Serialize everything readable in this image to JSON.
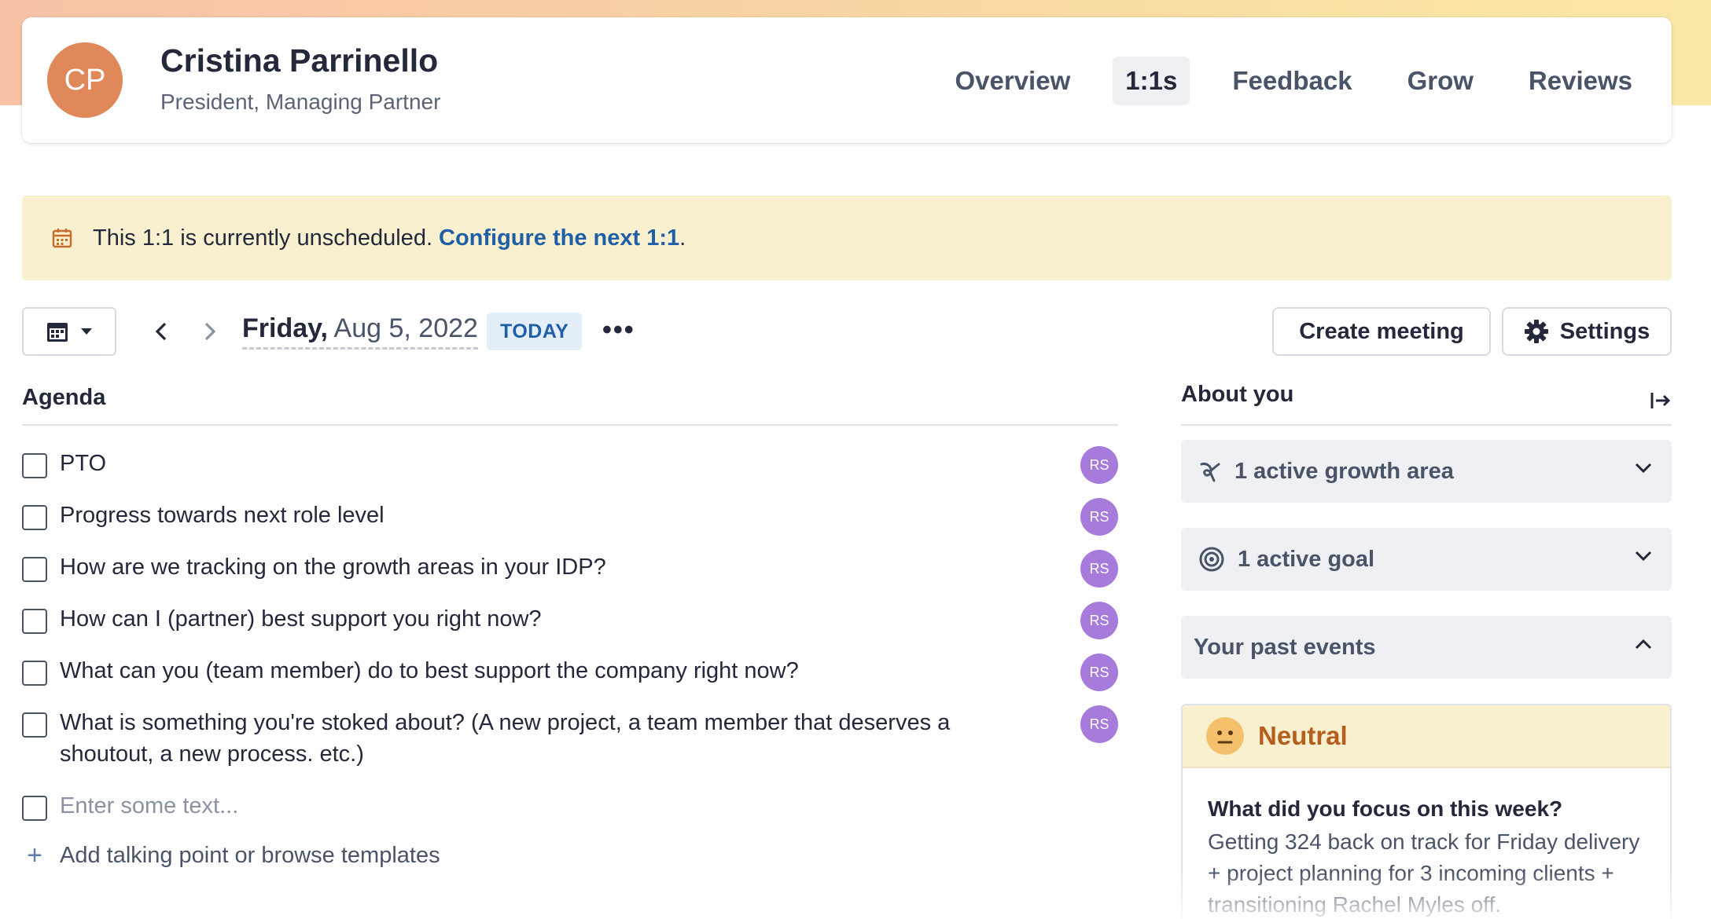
{
  "header": {
    "avatar_initials": "CP",
    "name": "Cristina Parrinello",
    "title": "President, Managing Partner",
    "tabs": [
      {
        "label": "Overview",
        "active": false
      },
      {
        "label": "1:1s",
        "active": true
      },
      {
        "label": "Feedback",
        "active": false
      },
      {
        "label": "Grow",
        "active": false
      },
      {
        "label": "Reviews",
        "active": false
      }
    ]
  },
  "banner": {
    "text": "This 1:1 is currently unscheduled.",
    "link": "Configure the next 1:1",
    "suffix": "."
  },
  "toolbar": {
    "weekday": "Friday,",
    "date": " Aug 5, 2022",
    "today_label": "TODAY",
    "more_label": "•••",
    "create_label": "Create meeting",
    "settings_label": "Settings"
  },
  "agenda": {
    "title": "Agenda",
    "items": [
      {
        "text": "PTO",
        "owner": "RS"
      },
      {
        "text": "Progress towards next role level",
        "owner": "RS"
      },
      {
        "text": "How are we tracking on the growth areas in your IDP?",
        "owner": "RS"
      },
      {
        "text": "How can I (partner) best support you right now?",
        "owner": "RS"
      },
      {
        "text": "What can you (team member) do to best support the company right now?",
        "owner": "RS"
      },
      {
        "text": "What is something you're stoked about? (A new project, a team member that deserves a shoutout, a new process. etc.)",
        "owner": "RS"
      }
    ],
    "input_placeholder": "Enter some text...",
    "add_label": "Add talking point or browse templates"
  },
  "about": {
    "title": "About you",
    "growth_label": "1 active growth area",
    "goal_label": "1 active goal",
    "past_events_label": "Your past events",
    "event": {
      "mood": "Neutral",
      "question": "What did you focus on this week?",
      "answer": "Getting 324 back on track for Friday delivery + project planning for 3 incoming clients + transitioning Rachel Myles off."
    }
  },
  "colors": {
    "accent_blue": "#1f5fa8",
    "avatar_orange": "#e0885a",
    "badge_purple": "#a77bdc",
    "banner_bg": "#f8f0cf",
    "mood_orange": "#b65e1e"
  }
}
